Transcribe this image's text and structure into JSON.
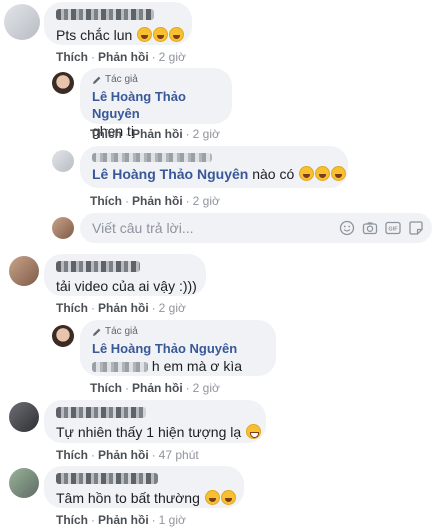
{
  "comments": [
    {
      "text": "Pts chắc lun",
      "time": "2 giờ"
    },
    {
      "author": "Lê Hoàng Thảo Nguyên",
      "badge": "Tác giả",
      "text": "ghen tị",
      "time": "2 giờ"
    },
    {
      "mention": "Lê Hoàng Thảo Nguyên",
      "text": "nào có",
      "time": "2 giờ"
    },
    {
      "text": "tải video của ai vậy :)))",
      "time": "2 giờ"
    },
    {
      "author": "Lê Hoàng Thảo Nguyên",
      "badge": "Tác giả",
      "text": "h em mà ơ kìa",
      "time": "2 giờ"
    },
    {
      "text": "Tự nhiên thấy 1 hiện tượng lạ",
      "time": "47 phút"
    },
    {
      "text": "Tâm hồn to bất thường",
      "time": "1 giờ"
    }
  ],
  "actions": {
    "like": "Thích",
    "reply": "Phản hồi",
    "sep": "·"
  },
  "reply_box": {
    "placeholder": "Viết câu trả lời..."
  },
  "icons": [
    "pencil-icon",
    "emoji-icon",
    "camera-icon",
    "gif-icon",
    "sticker-icon",
    "laughing-emoji"
  ]
}
